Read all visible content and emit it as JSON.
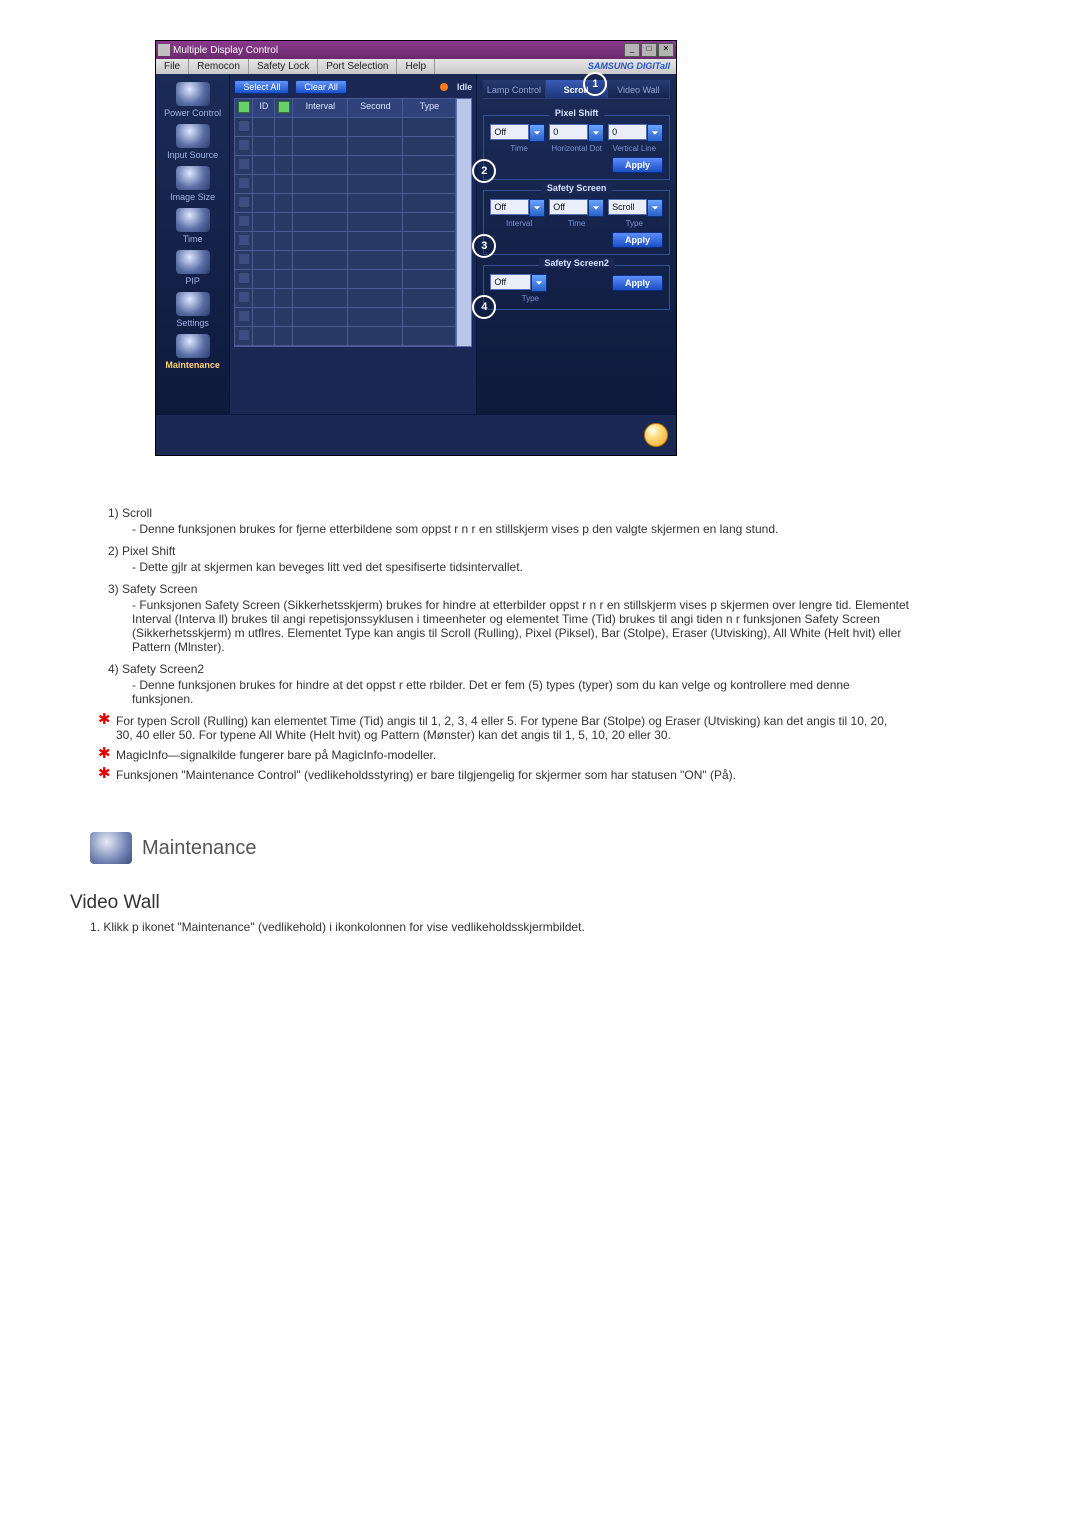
{
  "window": {
    "title": "Multiple Display Control",
    "brand": "SAMSUNG DIGITall"
  },
  "menubar": [
    "File",
    "Remocon",
    "Safety Lock",
    "Port Selection",
    "Help"
  ],
  "sidebar": [
    {
      "label": "Power Control"
    },
    {
      "label": "Input Source"
    },
    {
      "label": "Image Size"
    },
    {
      "label": "Time"
    },
    {
      "label": "PIP"
    },
    {
      "label": "Settings"
    },
    {
      "label": "Maintenance",
      "selected": true
    }
  ],
  "toolbar": {
    "select_all": "Select All",
    "clear_all": "Clear All",
    "idle": "Idle"
  },
  "grid": {
    "headers": {
      "id": "ID",
      "interval": "Interval",
      "second": "Second",
      "type": "Type"
    },
    "row_count": 12
  },
  "tabs": {
    "lamp": "Lamp Control",
    "scroll": "Scroll",
    "video_wall": "Video Wall",
    "active": "scroll"
  },
  "callouts": {
    "c1": "1",
    "c2": "2",
    "c3": "3",
    "c4": "4"
  },
  "pixel_shift": {
    "legend": "Pixel Shift",
    "time_value": "Off",
    "hdot_value": "0",
    "vline_value": "0",
    "labels": {
      "time": "Time",
      "hdot": "Horizontal Dot",
      "vline": "Vertical Line"
    },
    "apply": "Apply"
  },
  "safety_screen": {
    "legend": "Safety Screen",
    "interval_value": "Off",
    "time_value": "Off",
    "type_value": "Scroll",
    "labels": {
      "interval": "Interval",
      "time": "Time",
      "type": "Type"
    },
    "apply": "Apply"
  },
  "safety_screen2": {
    "legend": "Safety Screen2",
    "type_value": "Off",
    "labels": {
      "type": "Type"
    },
    "apply": "Apply"
  },
  "doc": {
    "items": [
      {
        "num": "1)",
        "title": "Scroll",
        "body": "Denne funksjonen brukes for   fjerne etterbildene som   oppst r n r en stillskjerm vises p  den valgte skjermen en lang stund."
      },
      {
        "num": "2)",
        "title": "Pixel Shift",
        "body": "Dette gjlr at skjermen kan beveges litt ved det spesifiserte tidsintervallet."
      },
      {
        "num": "3)",
        "title": "Safety Screen",
        "body": "Funksjonen Safety Screen (Sikkerhetsskjerm) brukes for   hindre at etterbilder oppst r n r en stillskjerm vises p  skjermen over lengre tid.  Elementet Interval (Interva  ll) brukes til   angi repetisjonssyklusen i timeenheter og elementet Time (Tid) brukes til   angi tiden n r funksjonen Safety Screen (Sikkerhetsskjerm) m  utflres. Elementet Type kan angis til Scroll (Rulling), Pixel (Piksel), Bar (Stolpe), Eraser (Utvisking), All White (Helt hvit) eller Pattern (Mlnster)."
      },
      {
        "num": "4)",
        "title": "Safety Screen2",
        "body": "Denne funksjonen brukes for   hindre at det oppst r ette  rbilder. Det er fem (5) types (typer) som du kan velge og kontrollere med denne funksjonen."
      }
    ],
    "stars": [
      "For typen Scroll (Rulling) kan elementet Time (Tid) angis til 1, 2, 3, 4 eller 5. For typene Bar (Stolpe) og Eraser (Utvisking) kan det angis til 10, 20, 30, 40 eller 50. For typene All White (Helt hvit) og Pattern (Mønster) kan det angis til 1, 5, 10, 20 eller 30.",
      "MagicInfo—signalkilde fungerer bare på MagicInfo-modeller.",
      "Funksjonen \"Maintenance Control\" (vedlikeholdsstyring) er bare tilgjengelig for skjermer som har statusen \"ON\" (På)."
    ],
    "section": {
      "title": "Maintenance"
    },
    "video_wall": {
      "heading": "Video Wall",
      "step1": "Klikk p  ikonet \"Maintenance\" (vedlikehold) i ikonkolonnen for   vise vedlikeholdsskjermbildet."
    }
  }
}
